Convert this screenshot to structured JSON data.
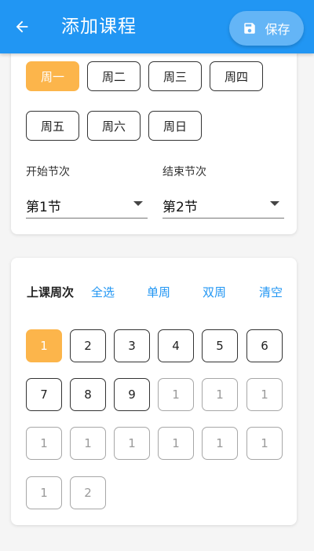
{
  "appbar": {
    "title": "添加课程",
    "save_label": "保存"
  },
  "days": [
    {
      "label": "周一",
      "selected": true
    },
    {
      "label": "周二",
      "selected": false
    },
    {
      "label": "周三",
      "selected": false
    },
    {
      "label": "周四",
      "selected": false
    },
    {
      "label": "周五",
      "selected": false
    },
    {
      "label": "周六",
      "selected": false
    },
    {
      "label": "周日",
      "selected": false
    }
  ],
  "start": {
    "label": "开始节次",
    "value": "第1节"
  },
  "end": {
    "label": "结束节次",
    "value": "第2节"
  },
  "weeks_section": {
    "title": "上课周次",
    "actions": [
      "全选",
      "单周",
      "双周",
      "清空"
    ]
  },
  "weeks": [
    {
      "label": "1",
      "state": "selected"
    },
    {
      "label": "2",
      "state": "normal"
    },
    {
      "label": "3",
      "state": "normal"
    },
    {
      "label": "4",
      "state": "normal"
    },
    {
      "label": "5",
      "state": "normal"
    },
    {
      "label": "6",
      "state": "normal"
    },
    {
      "label": "7",
      "state": "normal"
    },
    {
      "label": "8",
      "state": "normal"
    },
    {
      "label": "9",
      "state": "normal"
    },
    {
      "label": "1",
      "state": "dim"
    },
    {
      "label": "1",
      "state": "dim"
    },
    {
      "label": "1",
      "state": "dim"
    },
    {
      "label": "1",
      "state": "dim"
    },
    {
      "label": "1",
      "state": "dim"
    },
    {
      "label": "1",
      "state": "dim"
    },
    {
      "label": "1",
      "state": "dim"
    },
    {
      "label": "1",
      "state": "dim"
    },
    {
      "label": "1",
      "state": "dim"
    },
    {
      "label": "1",
      "state": "dim"
    },
    {
      "label": "2",
      "state": "dim"
    }
  ],
  "colors": {
    "primary": "#2196f3",
    "accent": "#fcb54b"
  }
}
